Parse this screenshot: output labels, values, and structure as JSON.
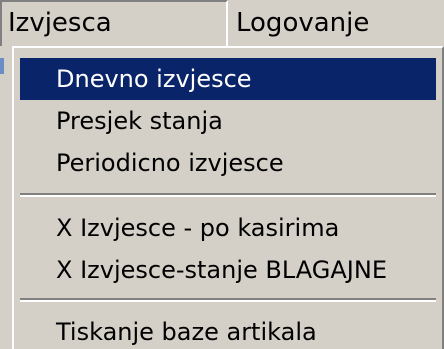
{
  "menubar": {
    "items": [
      {
        "label": "Izvjesca"
      },
      {
        "label": "Logovanje"
      }
    ]
  },
  "dropdown": {
    "items": [
      {
        "label": "Dnevno izvjesce"
      },
      {
        "label": "Presjek stanja"
      },
      {
        "label": "Periodicno izvjesce"
      },
      {
        "label": "X Izvjesce - po kasirima"
      },
      {
        "label": "X Izvjesce-stanje BLAGAJNE"
      },
      {
        "label": "Tiskanje baze artikala"
      }
    ]
  },
  "colors": {
    "face": "#d4d0c8",
    "highlight": "#0a246a",
    "highlight_text": "#ffffff",
    "shadow": "#808080"
  }
}
